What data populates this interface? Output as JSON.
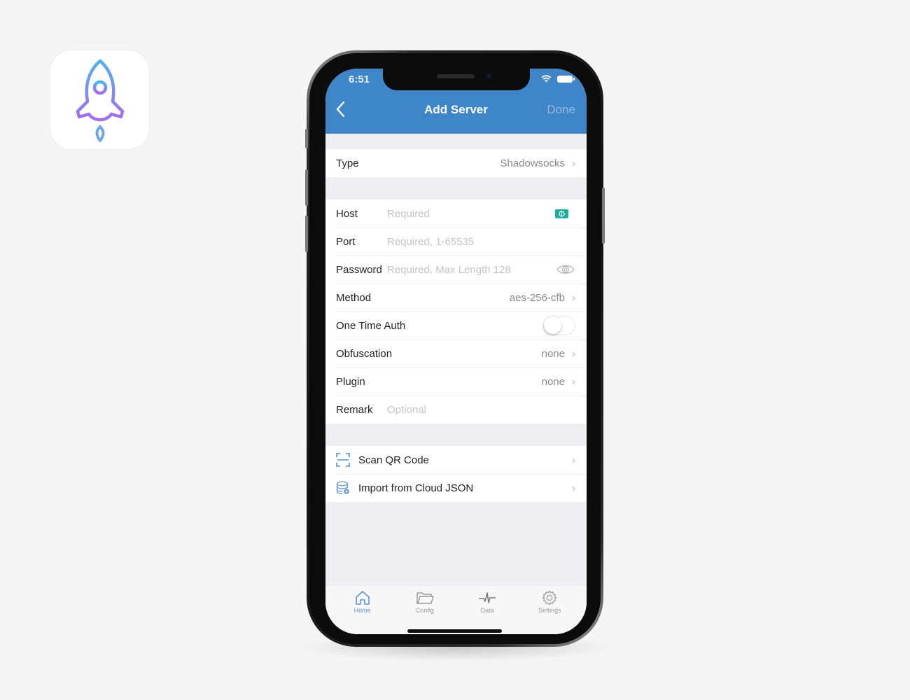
{
  "status_bar": {
    "time": "6:51"
  },
  "nav": {
    "title": "Add Server",
    "back_icon": "chevron-left-icon",
    "done_label": "Done"
  },
  "type_row": {
    "label": "Type",
    "value": "Shadowsocks"
  },
  "form": {
    "host": {
      "label": "Host",
      "placeholder": "Required",
      "icon": "globe-icon"
    },
    "port": {
      "label": "Port",
      "placeholder": "Required, 1-65535"
    },
    "password": {
      "label": "Password",
      "placeholder": "Required, Max Length 128",
      "icon": "eye-icon"
    },
    "method": {
      "label": "Method",
      "value": "aes-256-cfb"
    },
    "one_time_auth": {
      "label": "One Time Auth",
      "enabled": false
    },
    "obfuscation": {
      "label": "Obfuscation",
      "value": "none"
    },
    "plugin": {
      "label": "Plugin",
      "value": "none"
    },
    "remark": {
      "label": "Remark",
      "placeholder": "Optional"
    }
  },
  "actions": [
    {
      "label": "Scan QR Code",
      "icon": "qr-scan-icon"
    },
    {
      "label": "Import from Cloud JSON",
      "icon": "database-import-icon"
    }
  ],
  "tabbar": {
    "items": [
      {
        "label": "Home",
        "icon": "home-icon",
        "active": true
      },
      {
        "label": "Config",
        "icon": "folder-icon",
        "active": false
      },
      {
        "label": "Data",
        "icon": "pulse-icon",
        "active": false
      },
      {
        "label": "Settings",
        "icon": "gear-icon",
        "active": false
      }
    ]
  },
  "colors": {
    "header": "#3f86c9",
    "accent": "#5b95cf",
    "badge": "#1fae9c",
    "icon_gradient_top": "#4fb2f0",
    "icon_gradient_bottom": "#a26df0"
  }
}
